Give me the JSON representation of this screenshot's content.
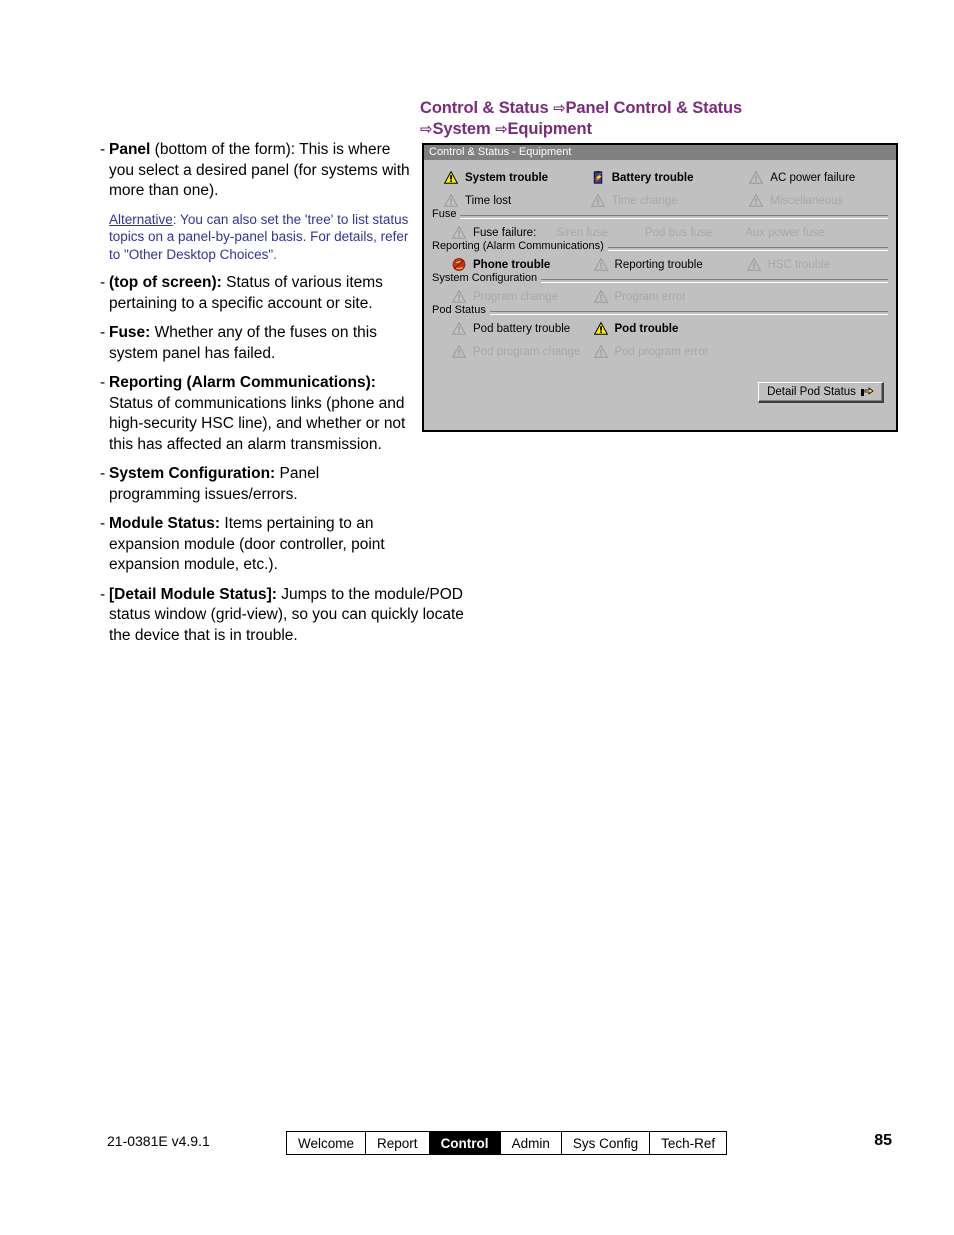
{
  "heading": {
    "line1_a": "Control & Status ",
    "line1_arrow": "⇨",
    "line1_b": "Panel Control & Status",
    "line2_arrow": "⇨",
    "line2_a": "System ",
    "line2_arrow2": "⇨",
    "line2_b": "Equipment",
    "color": "#7B2B7E"
  },
  "body_bullets": [
    {
      "dash": "-",
      "bold": "Panel",
      "rest": " (bottom of the form): This is where you select a desired panel (for systems with more than one)."
    },
    {
      "dash": "-",
      "bold": "(top of screen):",
      "rest": " Status of various items pertaining to a specific account or site."
    },
    {
      "dash": "-",
      "bold": "Fuse:",
      "rest": " Whether any of the fuses on this system panel has failed."
    },
    {
      "dash": "-",
      "bold": "Reporting (Alarm Communications):",
      "rest": " Status of communications links (phone and high-security HSC line), and whether or not this has affected an alarm transmission."
    },
    {
      "dash": "-",
      "bold": "System Configuration:",
      "rest": " Panel programming issues/errors."
    },
    {
      "dash": "-",
      "bold": "Module Status:",
      "rest": " Items pertaining to an expansion module (door controller, point expansion module, etc.)."
    },
    {
      "dash": "-",
      "bold": "[Detail Module Status]:",
      "rest": " Jumps to the module/POD status window (grid-view), so you can quickly locate the device that is in trouble."
    }
  ],
  "alt_note": {
    "label": "Alternative",
    "text": ":  You can also set the 'tree' to list status topics on a panel-by-panel basis. For details, refer to \"Other Desktop Choices\".",
    "color": "#333399"
  },
  "dialog": {
    "title": "Control & Status - Equipment",
    "rows_top": [
      [
        {
          "icon": "warning-triangle-yellow-icon",
          "label": "System trouble",
          "state": "alarm"
        },
        {
          "icon": "battery-trouble-icon",
          "label": "Battery trouble",
          "state": "alarm"
        },
        {
          "icon": "warning-triangle-gray-icon",
          "label": "AC power failure",
          "state": "normal"
        }
      ],
      [
        {
          "icon": "warning-triangle-gray-icon",
          "label": "Time lost",
          "state": "normal"
        },
        {
          "icon": "warning-triangle-gray-icon",
          "label": "Time change",
          "state": "off"
        },
        {
          "icon": "warning-triangle-gray-icon",
          "label": "Miscellaneous",
          "state": "off"
        }
      ]
    ],
    "groups": [
      {
        "caption": "Fuse",
        "rows": [
          [
            {
              "icon": "warning-triangle-gray-icon",
              "label": "Fuse failure:",
              "state": "normal"
            },
            {
              "icon": "none",
              "label": "Siren fuse",
              "state": "off"
            },
            {
              "icon": "none",
              "label": "Pod bus fuse",
              "state": "off"
            },
            {
              "icon": "none",
              "label": "Aux power fuse",
              "state": "off"
            }
          ]
        ]
      },
      {
        "caption": "Reporting (Alarm Communications)",
        "rows": [
          [
            {
              "icon": "phone-trouble-icon",
              "label": "Phone trouble",
              "state": "alarm"
            },
            {
              "icon": "warning-triangle-gray-icon",
              "label": "Reporting trouble",
              "state": "normal"
            },
            {
              "icon": "warning-triangle-gray-icon",
              "label": "HSC trouble",
              "state": "off"
            }
          ]
        ]
      },
      {
        "caption": "System Configuration",
        "rows": [
          [
            {
              "icon": "warning-triangle-gray-icon",
              "label": "Program change",
              "state": "off"
            },
            {
              "icon": "warning-triangle-gray-icon",
              "label": "Program error",
              "state": "off"
            },
            {
              "icon": "none",
              "label": "",
              "state": "off"
            }
          ]
        ]
      },
      {
        "caption": "Pod Status",
        "rows": [
          [
            {
              "icon": "warning-triangle-gray-icon",
              "label": "Pod battery trouble",
              "state": "normal"
            },
            {
              "icon": "warning-triangle-yellow-icon",
              "label": "Pod trouble",
              "state": "alarm"
            },
            {
              "icon": "none",
              "label": "",
              "state": "off"
            }
          ],
          [
            {
              "icon": "warning-triangle-gray-icon",
              "label": "Pod program change",
              "state": "off"
            },
            {
              "icon": "warning-triangle-gray-icon",
              "label": "Pod program error",
              "state": "off"
            },
            {
              "icon": "none",
              "label": "",
              "state": "off"
            }
          ]
        ]
      }
    ],
    "detail_button": {
      "label": "Detail Pod Status",
      "icon": "pointing-hand-icon"
    }
  },
  "footer": {
    "doc_code": "21-0381E v4.9.1",
    "tabs": [
      {
        "label": "Welcome",
        "active": false
      },
      {
        "label": "Report",
        "active": false
      },
      {
        "label": "Control",
        "active": true
      },
      {
        "label": "Admin",
        "active": false
      },
      {
        "label": "Sys Config",
        "active": false
      },
      {
        "label": "Tech-Ref",
        "active": false
      }
    ],
    "page_number": "85"
  }
}
